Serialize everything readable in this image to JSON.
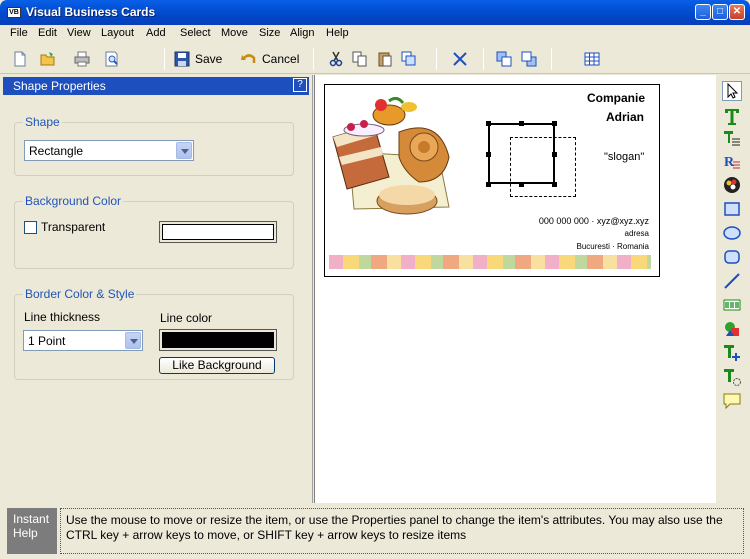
{
  "window": {
    "title": "Visual Business Cards",
    "app_icon_text": "VB"
  },
  "menu": [
    "File",
    "Edit",
    "View",
    "Layout",
    "Add",
    "Select",
    "Move",
    "Size",
    "Align",
    "Help"
  ],
  "toolbar": {
    "save_label": "Save",
    "cancel_label": "Cancel"
  },
  "panel": {
    "title": "Shape Properties",
    "help": "?",
    "shape_group": {
      "label": "Shape",
      "value": "Rectangle"
    },
    "bg_group": {
      "label": "Background Color",
      "transparent_label": "Transparent",
      "color": "#ffffff"
    },
    "border_group": {
      "label": "Border Color & Style",
      "thickness_label": "Line thickness",
      "thickness_value": "1 Point",
      "color_label": "Line color",
      "color": "#000000",
      "like_bg_label": "Like Background"
    }
  },
  "card": {
    "company": "Companie",
    "name": "Adrian",
    "slogan": "\"slogan\"",
    "phone_email": "000 000 000 · xyz@xyz.xyz",
    "address": "adresa",
    "city": "Bucuresti · Romania"
  },
  "tools": [
    "pointer-icon",
    "text-icon",
    "paragraph-icon",
    "rich-text-icon",
    "image-icon",
    "rectangle-icon",
    "ellipse-icon",
    "rounded-rect-icon",
    "line-icon",
    "barcode-icon",
    "shapes-icon",
    "add-text-icon",
    "text-rotate-icon",
    "callout-icon"
  ],
  "help": {
    "label": "Instant Help",
    "text": "Use the mouse to move or resize the item, or use the Properties panel to change the item's attributes. You may also use the CTRL key + arrow keys to move, or SHIFT key + arrow keys to resize items"
  }
}
